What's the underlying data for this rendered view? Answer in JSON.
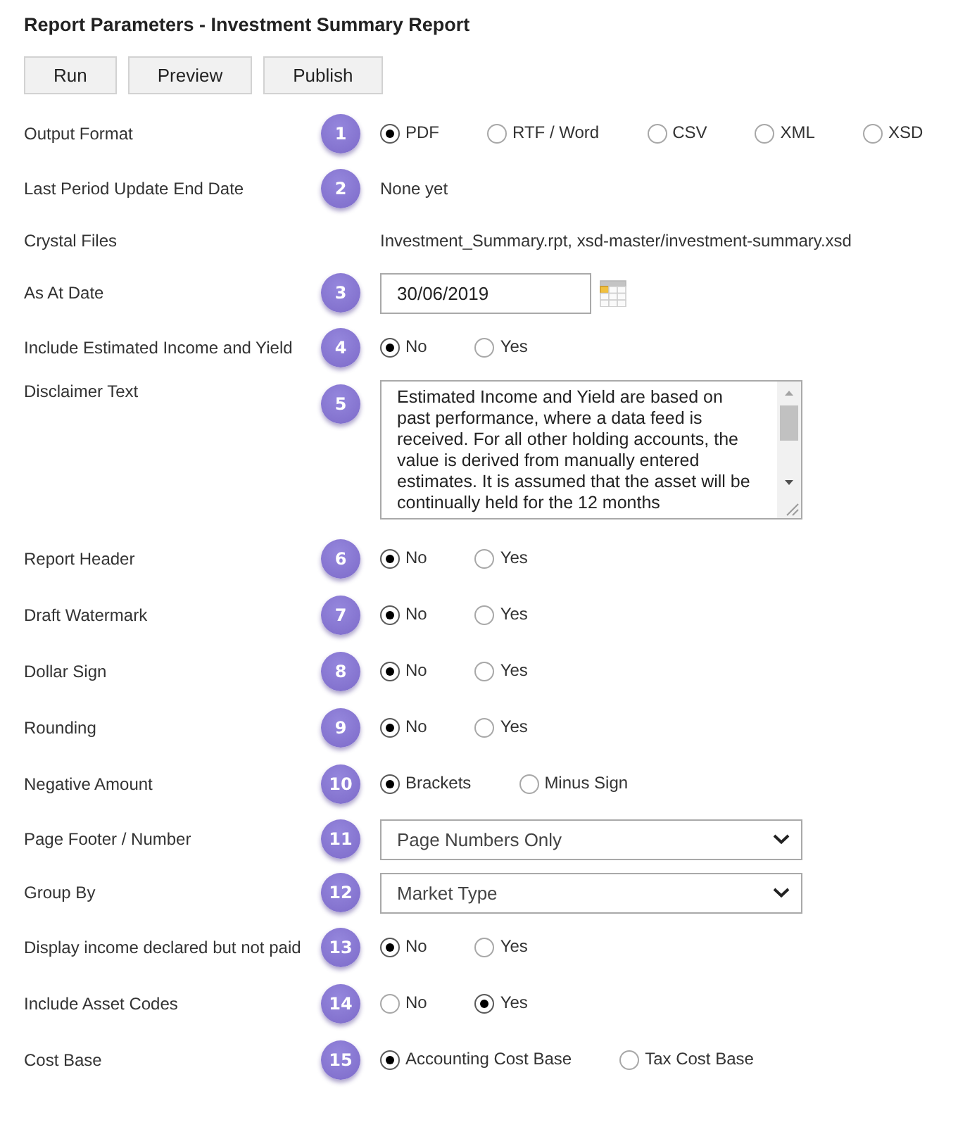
{
  "title": "Report Parameters - Investment Summary Report",
  "buttons": [
    "Run",
    "Preview",
    "Publish"
  ],
  "fields": [
    {
      "label": "Output Format",
      "marker": "1",
      "kind": "radio",
      "options": [
        {
          "label": "PDF",
          "selected": true
        },
        {
          "label": "RTF / Word",
          "selected": false
        },
        {
          "label": "CSV",
          "selected": false
        },
        {
          "label": "XML",
          "selected": false
        },
        {
          "label": "XSD",
          "selected": false
        }
      ]
    },
    {
      "label": "Last Period Update End Date",
      "marker": "2",
      "kind": "text",
      "value": "None yet"
    },
    {
      "label": "Crystal Files",
      "kind": "text",
      "value": "Investment_Summary.rpt, xsd-master/investment-summary.xsd"
    },
    {
      "label": "As At Date",
      "marker": "3",
      "kind": "date",
      "value": "30/06/2019"
    },
    {
      "label": "Include Estimated Income and Yield",
      "marker": "4",
      "kind": "radio",
      "options": [
        {
          "label": "No",
          "selected": true
        },
        {
          "label": "Yes",
          "selected": false
        }
      ]
    },
    {
      "label": "Disclaimer Text",
      "marker": "5",
      "kind": "textarea",
      "value": "Estimated Income and Yield are based on past performance, where a data feed is received. For all other holding accounts, the value is derived from manually entered estimates. It is assumed that the asset will be continually held for the 12 months"
    },
    {
      "label": "Report Header",
      "marker": "6",
      "kind": "radio",
      "options": [
        {
          "label": "No",
          "selected": true
        },
        {
          "label": "Yes",
          "selected": false
        }
      ]
    },
    {
      "label": "Draft Watermark",
      "marker": "7",
      "kind": "radio",
      "options": [
        {
          "label": "No",
          "selected": true
        },
        {
          "label": "Yes",
          "selected": false
        }
      ]
    },
    {
      "label": "Dollar Sign",
      "marker": "8",
      "kind": "radio",
      "options": [
        {
          "label": "No",
          "selected": true
        },
        {
          "label": "Yes",
          "selected": false
        }
      ]
    },
    {
      "label": "Rounding",
      "marker": "9",
      "kind": "radio",
      "options": [
        {
          "label": "No",
          "selected": true
        },
        {
          "label": "Yes",
          "selected": false
        }
      ]
    },
    {
      "label": "Negative Amount",
      "marker": "10",
      "kind": "radio",
      "options": [
        {
          "label": "Brackets",
          "selected": true
        },
        {
          "label": "Minus Sign",
          "selected": false
        }
      ]
    },
    {
      "label": "Page Footer / Number",
      "marker": "11",
      "kind": "select",
      "value": "Page Numbers Only"
    },
    {
      "label": "Group By",
      "marker": "12",
      "kind": "select",
      "value": "Market Type"
    },
    {
      "label": "Display income declared but not paid",
      "marker": "13",
      "kind": "radio",
      "options": [
        {
          "label": "No",
          "selected": true
        },
        {
          "label": "Yes",
          "selected": false
        }
      ]
    },
    {
      "label": "Include Asset Codes",
      "marker": "14",
      "kind": "radio",
      "options": [
        {
          "label": "No",
          "selected": false
        },
        {
          "label": "Yes",
          "selected": true
        }
      ]
    },
    {
      "label": "Cost Base",
      "marker": "15",
      "kind": "radio",
      "options": [
        {
          "label": "Accounting Cost Base",
          "selected": true
        },
        {
          "label": "Tax Cost Base",
          "selected": false
        }
      ]
    }
  ]
}
